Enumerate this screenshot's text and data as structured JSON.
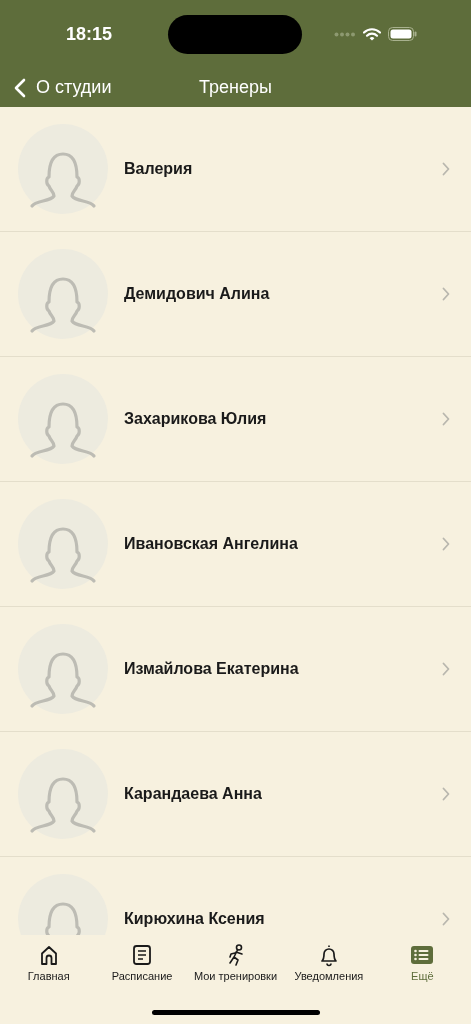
{
  "status_bar": {
    "time": "18:15"
  },
  "nav": {
    "back": "О студии",
    "title": "Тренеры"
  },
  "trainers": [
    {
      "name": "Валерия"
    },
    {
      "name": "Демидович Алина"
    },
    {
      "name": "Захарикова Юлия"
    },
    {
      "name": "Ивановская Ангелина"
    },
    {
      "name": "Измайлова Екатерина"
    },
    {
      "name": "Карандаева Анна"
    },
    {
      "name": "Кирюхина Ксения"
    }
  ],
  "tabs": [
    {
      "kind": "home",
      "label": "Главная",
      "selected": false
    },
    {
      "kind": "schedule",
      "label": "Расписание",
      "selected": false
    },
    {
      "kind": "workouts",
      "label": "Мои тренировки",
      "selected": false
    },
    {
      "kind": "notifications",
      "label": "Уведомления",
      "selected": false
    },
    {
      "kind": "more",
      "label": "Ещё",
      "selected": true
    }
  ]
}
